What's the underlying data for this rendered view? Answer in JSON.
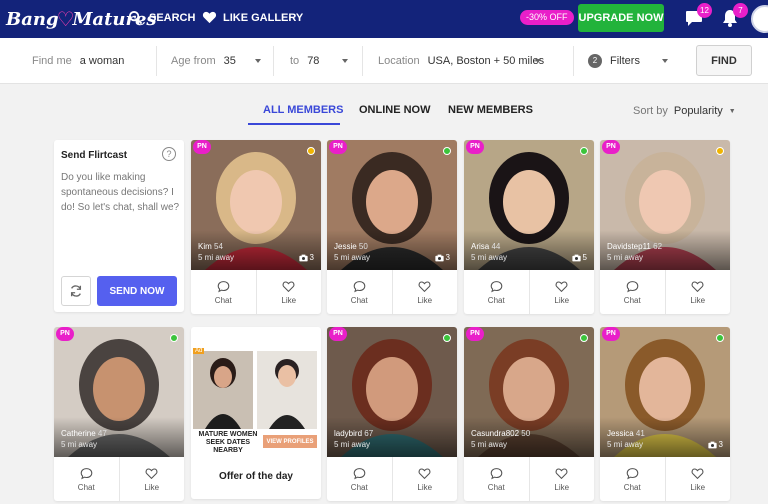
{
  "header": {
    "logo_text_left": "Bang",
    "logo_text_right": "Matures",
    "search_label": "SEARCH",
    "like_gallery_label": "LIKE GALLERY",
    "discount_badge": "-30% OFF",
    "upgrade_label": "UPGRADE NOW",
    "messages_count": "12",
    "notifications_count": "7"
  },
  "filters": {
    "find_me_label": "Find me",
    "find_me_value": "a woman",
    "age_from_label": "Age from",
    "age_from_value": "35",
    "age_to_label": "to",
    "age_to_value": "78",
    "location_label": "Location",
    "location_value": "USA, Boston + 50 miles",
    "filters_count": "2",
    "filters_label": "Filters",
    "find_button": "FIND"
  },
  "tabs": [
    {
      "label": "ALL MEMBERS",
      "active": true
    },
    {
      "label": "ONLINE NOW",
      "active": false
    },
    {
      "label": "NEW MEMBERS",
      "active": false
    }
  ],
  "sort": {
    "label": "Sort by",
    "value": "Popularity"
  },
  "flirtcast": {
    "title": "Send Flirtcast",
    "help": "?",
    "message": "Do you like making spontaneous decisions? I do! So let's chat, shall we?",
    "send_button": "SEND NOW"
  },
  "actions": {
    "chat": "Chat",
    "like": "Like"
  },
  "pn_badge": "PN",
  "members": [
    {
      "name": "Kim",
      "age": "54",
      "distance": "5 mi away",
      "photos": "3",
      "status": "away",
      "status_color": "#f0b400",
      "hair": "#d9b888",
      "bg": "#8a6d5a",
      "skin": "#f0c8b0",
      "top": "#c62a3a"
    },
    {
      "name": "Jessie",
      "age": "50",
      "distance": "5 mi away",
      "photos": "3",
      "status": "online",
      "status_color": "#3bc43b",
      "hair": "#3a2a22",
      "bg": "#a07b62",
      "skin": "#dca88a",
      "top": "#2b2b2b"
    },
    {
      "name": "Arisa",
      "age": "44",
      "distance": "5 mi away",
      "photos": "5",
      "status": "online",
      "status_color": "#3bc43b",
      "hair": "#1a1416",
      "bg": "#b7a687",
      "skin": "#e8c2a4",
      "top": "#444"
    },
    {
      "name": "Davidstep11",
      "age": "62",
      "distance": "5 mi away",
      "photos": "",
      "status": "away",
      "status_color": "#f0b400",
      "hair": "#c8b39a",
      "bg": "#c9b9aa",
      "skin": "#efc8b2",
      "top": "#b04050"
    },
    {
      "name": "Catherine",
      "age": "47",
      "distance": "5 mi away",
      "photos": "",
      "status": "online",
      "status_color": "#3bc43b",
      "hair": "#4a4340",
      "bg": "#d4ccc4",
      "skin": "#c7926f",
      "top": "#6a6a6a"
    },
    {
      "name": "ladybird",
      "age": "67",
      "distance": "5 mi away",
      "photos": "",
      "status": "online",
      "status_color": "#3bc43b",
      "hair": "#6b2e1f",
      "bg": "#6e5a4c",
      "skin": "#d19a7c",
      "top": "#2f6b70"
    },
    {
      "name": "Casundra802",
      "age": "50",
      "distance": "5 mi away",
      "photos": "",
      "status": "online",
      "status_color": "#3bc43b",
      "hair": "#7a3d25",
      "bg": "#7f6a55",
      "skin": "#d8a78a",
      "top": "#5a4030"
    },
    {
      "name": "Jessica",
      "age": "41",
      "distance": "5 mi away",
      "photos": "3",
      "status": "online",
      "status_color": "#3bc43b",
      "hair": "#8a5a2a",
      "bg": "#b59a78",
      "skin": "#e3b69a",
      "top": "#e0c848"
    }
  ],
  "ad": {
    "tag": "Ad",
    "title": "MATURE WOMEN SEEK DATES NEARBY",
    "button": "VIEW PROFILES",
    "offer": "Offer of the day"
  }
}
